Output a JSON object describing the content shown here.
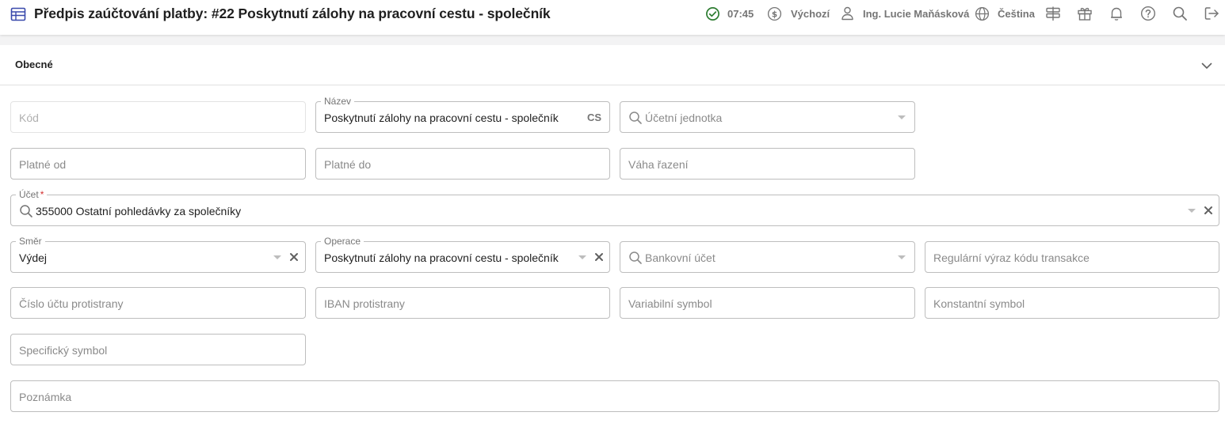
{
  "header": {
    "title": "Předpis zaúčtování platby: #22 Poskytnutí zálohy na pracovní cestu - společník",
    "time": "07:45",
    "currency_profile": "Výchozí",
    "user": "Ing. Lucie Maňásková",
    "language": "Čeština",
    "icons": [
      "table-icon",
      "check-circle-icon",
      "dollar-circle-icon",
      "user-icon",
      "globe-icon",
      "signpost-icon",
      "gift-icon",
      "bell-icon",
      "help-icon",
      "search-icon",
      "logout-icon"
    ],
    "accent_color": "#2e7d32",
    "brand_color": "#3949ab"
  },
  "section": {
    "label": "Obecné"
  },
  "form": {
    "kod": {
      "placeholder": "Kód"
    },
    "nazev": {
      "label": "Název",
      "value": "Poskytnutí zálohy na pracovní cestu - společník",
      "lang": "CS"
    },
    "ucetni_jednotka": {
      "placeholder": "Účetní jednotka"
    },
    "platne_od": {
      "placeholder": "Platné od"
    },
    "platne_do": {
      "placeholder": "Platné do"
    },
    "vaha_razeni": {
      "placeholder": "Váha řazení"
    },
    "ucet": {
      "label": "Účet",
      "required_mark": "*",
      "value": "355000 Ostatní pohledávky za společníky"
    },
    "smer": {
      "label": "Směr",
      "value": "Výdej"
    },
    "operace": {
      "label": "Operace",
      "value": "Poskytnutí zálohy na pracovní cestu - společník"
    },
    "bankovni_ucet": {
      "placeholder": "Bankovní účet"
    },
    "regularni_vyraz": {
      "placeholder": "Regulární výraz kódu transakce"
    },
    "cislo_uctu_protistrany": {
      "placeholder": "Číslo účtu protistrany"
    },
    "iban_protistrany": {
      "placeholder": "IBAN protistrany"
    },
    "variabilni_symbol": {
      "placeholder": "Variabilní symbol"
    },
    "konstantni_symbol": {
      "placeholder": "Konstantní symbol"
    },
    "specificky_symbol": {
      "placeholder": "Specifický symbol"
    },
    "poznamka": {
      "placeholder": "Poznámka"
    }
  }
}
